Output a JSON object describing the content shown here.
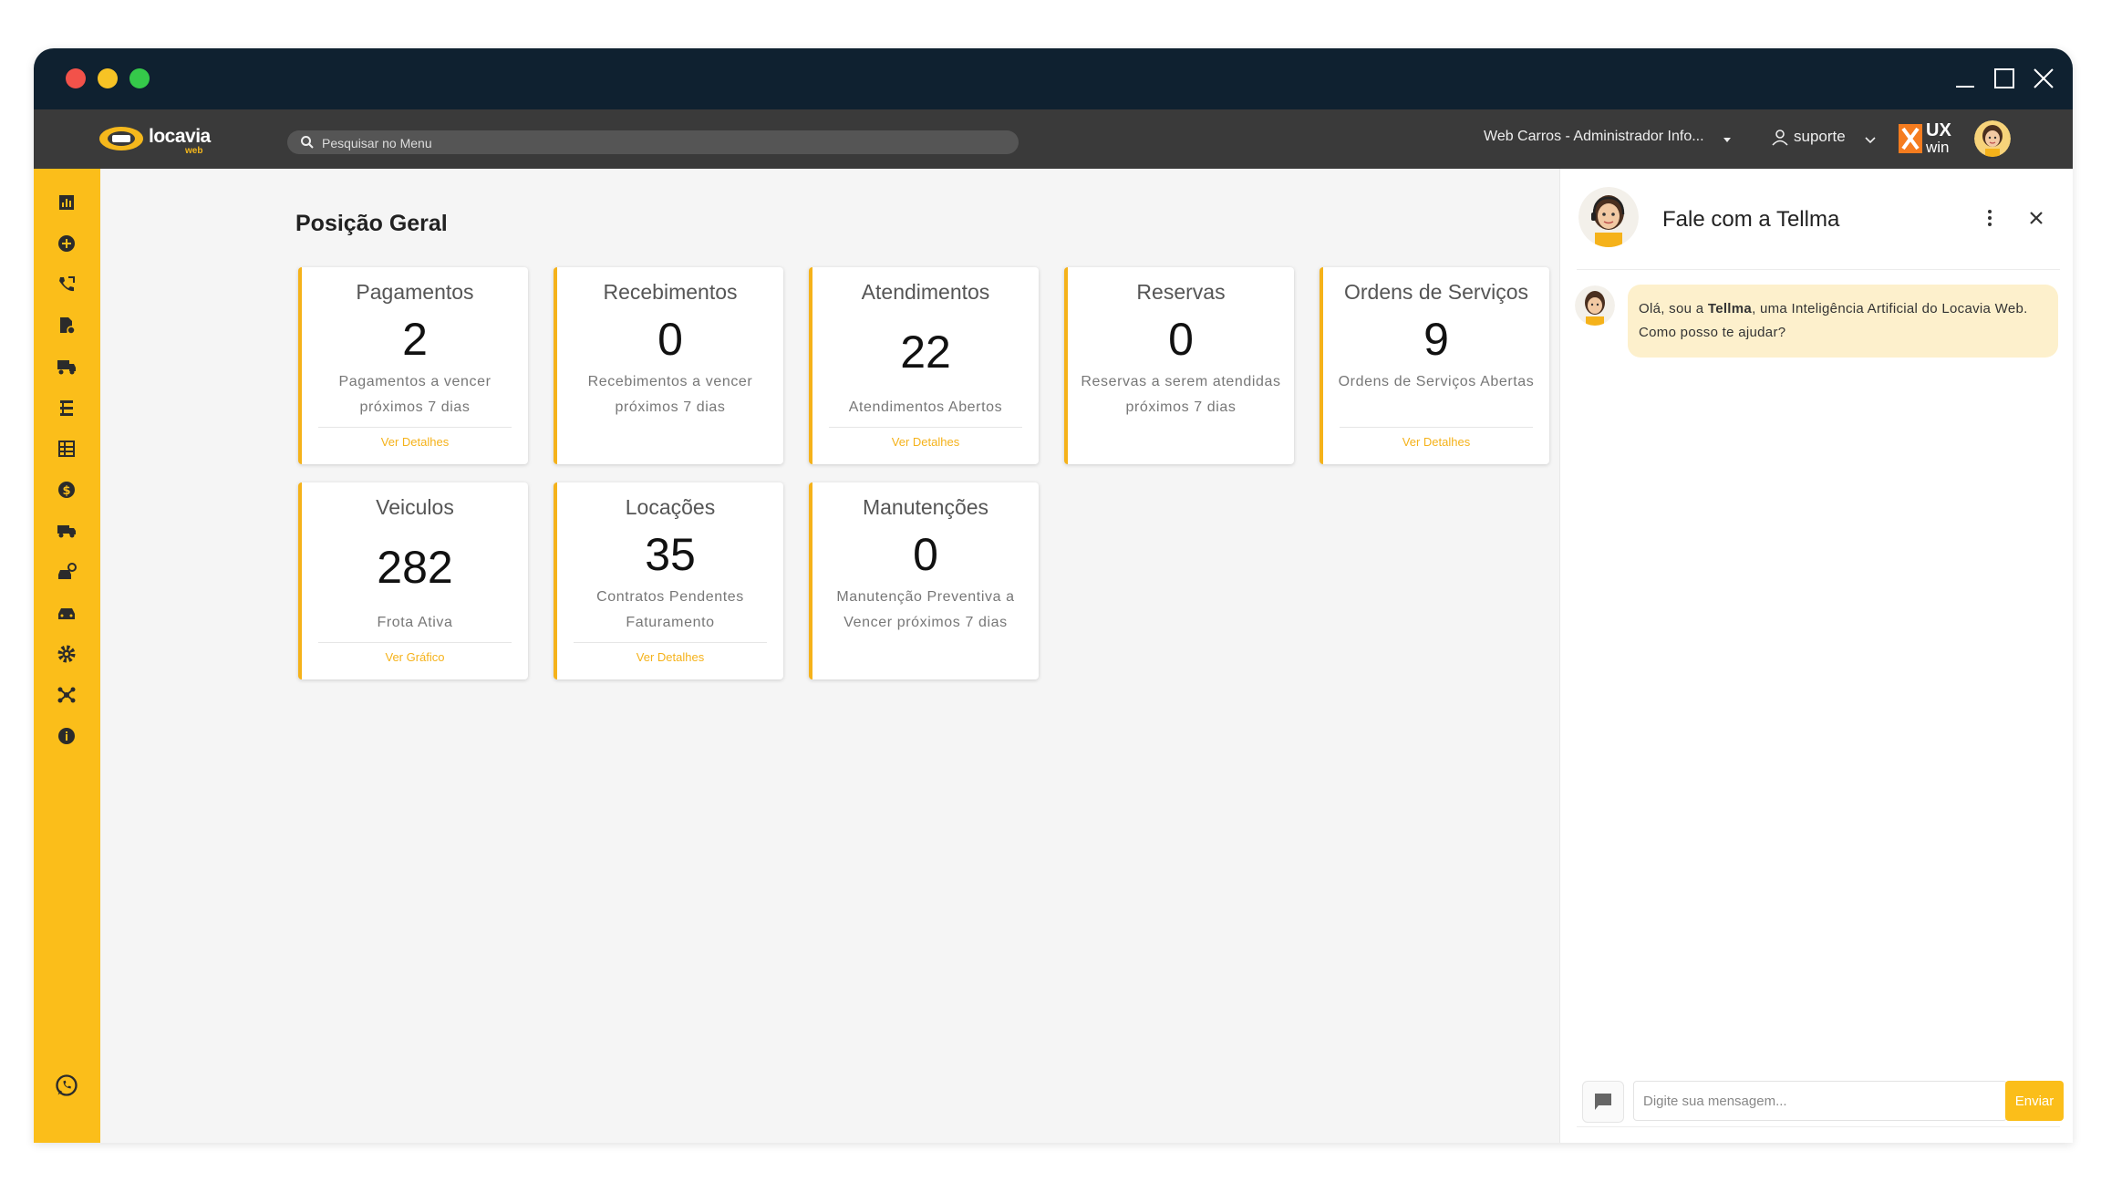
{
  "window": {
    "controls": [
      "minimize",
      "maximize",
      "close"
    ]
  },
  "header": {
    "logo_text": "locavia",
    "logo_sub": "web",
    "search_placeholder": "Pesquisar no Menu",
    "company": "Web Carros - Administrador Info...",
    "user": "suporte",
    "brand": "UX win",
    "brand_ux": "UX",
    "brand_win": "win"
  },
  "sidebar": {
    "icons": [
      "dashboard-icon",
      "add-circle-icon",
      "phone-icon",
      "document-settings-icon",
      "delivery-truck-icon",
      "road-icon",
      "table-icon",
      "dollar-icon",
      "truck-icon",
      "car-wash-icon",
      "car-icon",
      "gear-icon",
      "network-icon",
      "info-icon",
      "whatsapp-icon"
    ]
  },
  "page": {
    "title": "Posição Geral"
  },
  "cards": [
    {
      "title": "Pagamentos",
      "value": "2",
      "desc": "Pagamentos a vencer próximos 7 dias",
      "link": "Ver Detalhes"
    },
    {
      "title": "Recebimentos",
      "value": "0",
      "desc": "Recebimentos a vencer próximos 7 dias",
      "link": ""
    },
    {
      "title": "Atendimentos",
      "value": "22",
      "desc": "Atendimentos Abertos",
      "link": "Ver Detalhes"
    },
    {
      "title": "Reservas",
      "value": "0",
      "desc": "Reservas a serem atendidas próximos 7 dias",
      "link": ""
    },
    {
      "title": "Ordens de Serviços",
      "value": "9",
      "desc": "Ordens de Serviços Abertas",
      "link": "Ver Detalhes"
    },
    {
      "title": "Veiculos",
      "value": "282",
      "desc": "Frota Ativa",
      "link": "Ver Gráfico"
    },
    {
      "title": "Locações",
      "value": "35",
      "desc": "Contratos Pendentes Faturamento",
      "link": "Ver Detalhes"
    },
    {
      "title": "Manutenções",
      "value": "0",
      "desc": "Manutenção Preventiva a Vencer próximos 7 dias",
      "link": ""
    }
  ],
  "chat": {
    "title": "Fale com a Tellma",
    "message_prefix": "Olá, sou a ",
    "message_name": "Tellma",
    "message_suffix": ", uma Inteligência Artificial do Locavia Web. Como posso te ajudar?",
    "input_placeholder": "Digite sua mensagem...",
    "send_label": "Enviar"
  },
  "colors": {
    "accent": "#fbbe1a",
    "titlebar": "#0f2130",
    "appbar": "#3a3a3a"
  }
}
